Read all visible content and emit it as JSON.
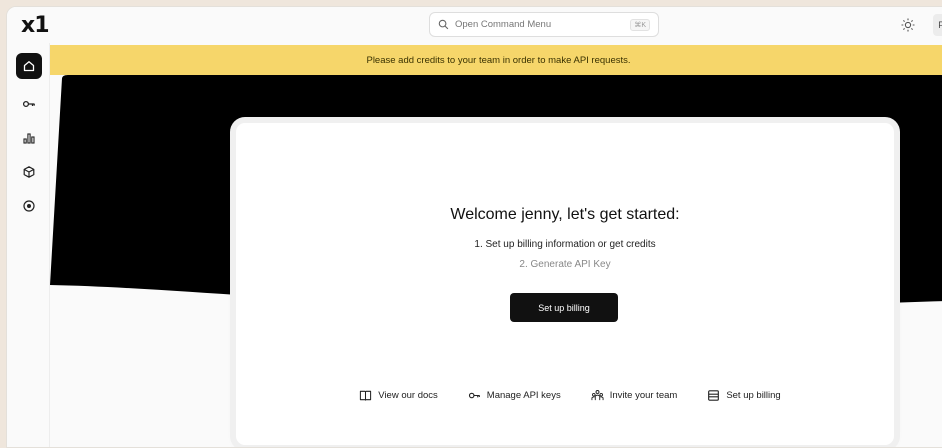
{
  "app": {
    "logo_text": "x1"
  },
  "topbar": {
    "command_placeholder": "Open Command Menu",
    "shortcut": "⌘K",
    "theme_icon": "sun-icon",
    "avatar_initial": "F"
  },
  "sidebar": {
    "items": [
      {
        "icon": "home-icon",
        "active": true
      },
      {
        "icon": "key-icon",
        "active": false
      },
      {
        "icon": "bar-chart-icon",
        "active": false
      },
      {
        "icon": "cube-icon",
        "active": false
      },
      {
        "icon": "target-icon",
        "active": false
      }
    ]
  },
  "banner": {
    "text": "Please add credits to your team in order to make API requests.",
    "color": "#f6d66a"
  },
  "card": {
    "welcome": "Welcome jenny, let's get started:",
    "step1": "1. Set up billing information or get credits",
    "step2": "2. Generate API Key",
    "cta_label": "Set up billing",
    "links": [
      {
        "icon": "book-icon",
        "label": "View our docs"
      },
      {
        "icon": "key-icon",
        "label": "Manage API keys"
      },
      {
        "icon": "team-icon",
        "label": "Invite your team"
      },
      {
        "icon": "billing-icon",
        "label": "Set up billing"
      }
    ]
  }
}
